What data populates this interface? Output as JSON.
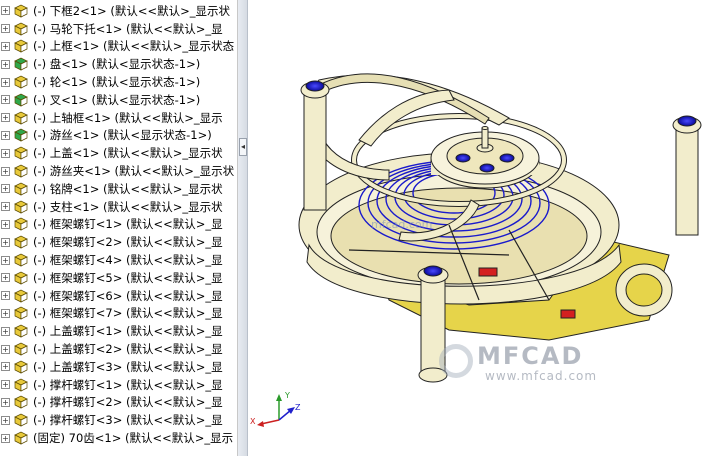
{
  "tree": {
    "items": [
      {
        "text": "(-) 下框2<1> (默认<<默认>_显示状",
        "icon": "part-icon"
      },
      {
        "text": "(-) 马轮下托<1> (默认<<默认>_显",
        "icon": "part-icon"
      },
      {
        "text": "(-) 上框<1> (默认<<默认>_显示状态",
        "icon": "part-icon"
      },
      {
        "text": "(-) 盘<1> (默认<显示状态-1>)",
        "icon": "part-icon-green"
      },
      {
        "text": "(-) 轮<1> (默认<显示状态-1>)",
        "icon": "part-icon"
      },
      {
        "text": "(-) 叉<1> (默认<显示状态-1>)",
        "icon": "part-icon-green"
      },
      {
        "text": "(-) 上轴框<1> (默认<<默认>_显示",
        "icon": "part-icon"
      },
      {
        "text": "(-) 游丝<1> (默认<显示状态-1>)",
        "icon": "part-icon-green"
      },
      {
        "text": "(-) 上盖<1> (默认<<默认>_显示状",
        "icon": "part-icon"
      },
      {
        "text": "(-) 游丝夹<1> (默认<<默认>_显示状",
        "icon": "part-icon"
      },
      {
        "text": "(-) 铭牌<1> (默认<<默认>_显示状",
        "icon": "part-icon"
      },
      {
        "text": "(-) 支柱<1> (默认<<默认>_显示状",
        "icon": "part-icon"
      },
      {
        "text": "(-) 框架螺钉<1> (默认<<默认>_显",
        "icon": "part-icon"
      },
      {
        "text": "(-) 框架螺钉<2> (默认<<默认>_显",
        "icon": "part-icon"
      },
      {
        "text": "(-) 框架螺钉<4> (默认<<默认>_显",
        "icon": "part-icon"
      },
      {
        "text": "(-) 框架螺钉<5> (默认<<默认>_显",
        "icon": "part-icon"
      },
      {
        "text": "(-) 框架螺钉<6> (默认<<默认>_显",
        "icon": "part-icon"
      },
      {
        "text": "(-) 框架螺钉<7> (默认<<默认>_显",
        "icon": "part-icon"
      },
      {
        "text": "(-) 上盖螺钉<1> (默认<<默认>_显",
        "icon": "part-icon"
      },
      {
        "text": "(-) 上盖螺钉<2> (默认<<默认>_显",
        "icon": "part-icon"
      },
      {
        "text": "(-) 上盖螺钉<3> (默认<<默认>_显",
        "icon": "part-icon"
      },
      {
        "text": "(-) 撑杆螺钉<1> (默认<<默认>_显",
        "icon": "part-icon"
      },
      {
        "text": "(-) 撑杆螺钉<2> (默认<<默认>_显",
        "icon": "part-icon"
      },
      {
        "text": "(-) 撑杆螺钉<3> (默认<<默认>_显",
        "icon": "part-icon"
      },
      {
        "text": "(固定) 70齿<1> (默认<<默认>_显示",
        "icon": "part-icon"
      }
    ]
  },
  "viewport": {
    "axes": {
      "x": "X",
      "y": "Y",
      "z": "Z"
    },
    "watermark_logo": "MFCAD",
    "watermark_url": "www.mfcad.com",
    "mid_watermark": "mfcad.com"
  },
  "colors": {
    "part_yellow": "#e8c93a",
    "part_green": "#2fa84a",
    "model_body": "#f2edcc",
    "model_blue": "#1a1acc",
    "model_yellow": "#e6d44a",
    "model_red": "#d42020"
  }
}
